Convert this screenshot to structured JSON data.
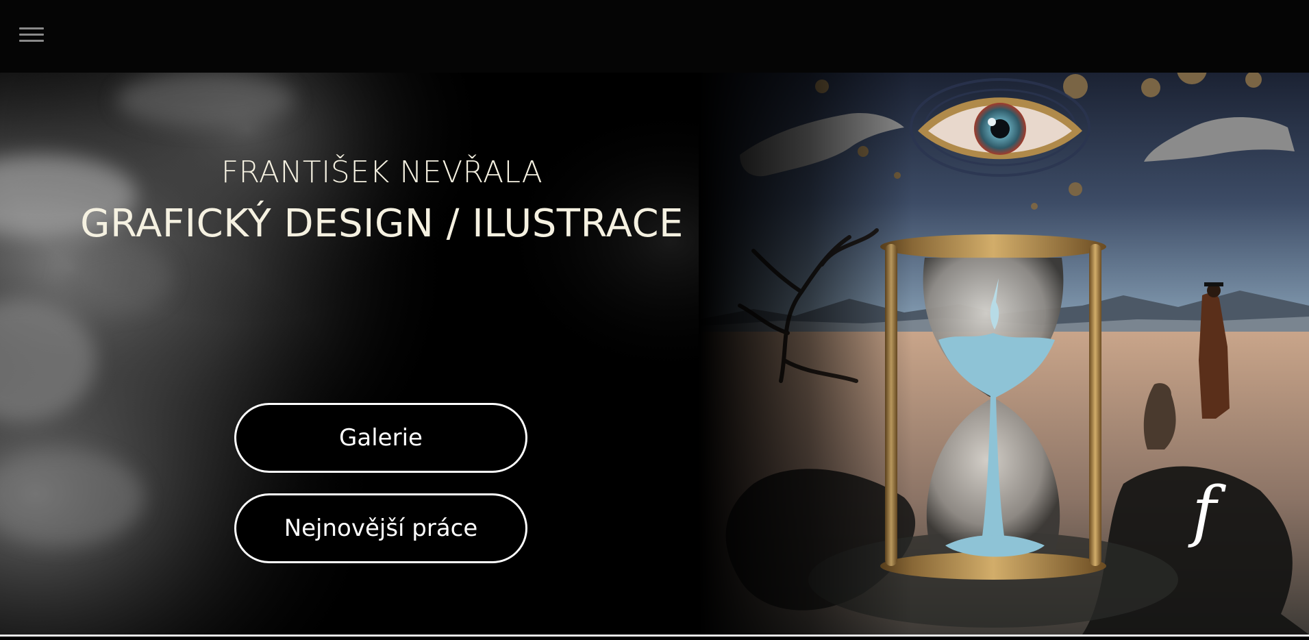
{
  "header": {
    "menu_icon": "hamburger-menu-icon"
  },
  "hero": {
    "name": "FRANTIŠEK NEVŘALA",
    "tagline": "GRAFICKÝ DESIGN / ILUSTRACE",
    "buttons": {
      "gallery_label": "Galerie",
      "latest_label": "Nejnovější práce"
    },
    "art_monogram": "f"
  },
  "colors": {
    "background": "#000000",
    "heading_text": "#f5f1e1",
    "button_border": "#ffffff"
  }
}
